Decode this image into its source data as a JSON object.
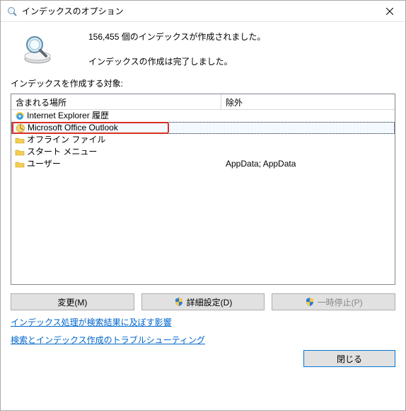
{
  "window": {
    "title": "インデックスのオプション"
  },
  "status": {
    "line1": "156,455 個のインデックスが作成されました。",
    "line2": "インデックスの作成は完了しました。"
  },
  "label_target": "インデックスを作成する対象:",
  "columns": {
    "location": "含まれる場所",
    "exclude": "除外"
  },
  "rows": {
    "r0": {
      "label": "Internet Explorer 履歴",
      "exclude": ""
    },
    "r1": {
      "label": "Microsoft Office Outlook",
      "exclude": ""
    },
    "r2": {
      "label": "オフライン ファイル",
      "exclude": ""
    },
    "r3": {
      "label": "スタート メニュー",
      "exclude": ""
    },
    "r4": {
      "label": "ユーザー",
      "exclude": "AppData; AppData"
    }
  },
  "buttons": {
    "modify": "変更(M)",
    "advanced": "詳細設定(D)",
    "pause": "一時停止(P)",
    "close": "閉じる"
  },
  "links": {
    "impact": "インデックス処理が検索結果に及ぼす影響",
    "troubleshoot": "検索とインデックス作成のトラブルシューティング"
  }
}
